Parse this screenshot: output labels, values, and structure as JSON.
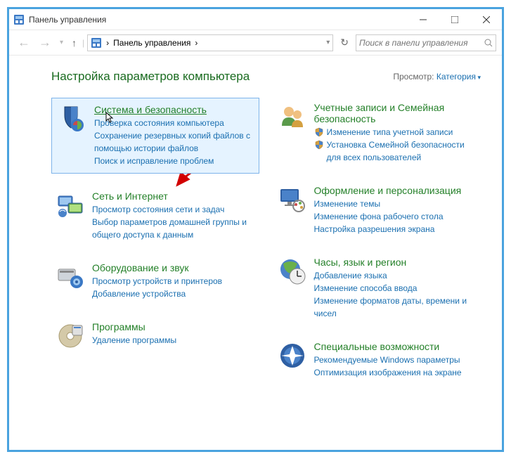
{
  "window": {
    "title": "Панель управления"
  },
  "address": {
    "breadcrumb": "Панель управления",
    "chevron": "›"
  },
  "search": {
    "placeholder": "Поиск в панели управления"
  },
  "header": {
    "title": "Настройка параметров компьютера"
  },
  "view_by": {
    "label": "Просмотр:",
    "mode": "Категория"
  },
  "left_col": [
    {
      "id": "system-security",
      "title": "Система и безопасность",
      "highlight": true,
      "subs": [
        {
          "text": "Проверка состояния компьютера"
        },
        {
          "text": "Сохранение резервных копий файлов с помощью истории файлов"
        },
        {
          "text": "Поиск и исправление проблем"
        }
      ]
    },
    {
      "id": "network",
      "title": "Сеть и Интернет",
      "subs": [
        {
          "text": "Просмотр состояния сети и задач"
        },
        {
          "text": "Выбор параметров домашней группы и общего доступа к данным"
        }
      ]
    },
    {
      "id": "hardware-sound",
      "title": "Оборудование и звук",
      "subs": [
        {
          "text": "Просмотр устройств и принтеров"
        },
        {
          "text": "Добавление устройства"
        }
      ]
    },
    {
      "id": "programs",
      "title": "Программы",
      "subs": [
        {
          "text": "Удаление программы"
        }
      ]
    }
  ],
  "right_col": [
    {
      "id": "user-accounts",
      "title": "Учетные записи и Семейная безопасность",
      "subs": [
        {
          "text": "Изменение типа учетной записи",
          "shield": true
        },
        {
          "text": "Установка Семейной безопасности для всех пользователей",
          "shield": true
        }
      ]
    },
    {
      "id": "appearance",
      "title": "Оформление и персонализация",
      "subs": [
        {
          "text": "Изменение темы"
        },
        {
          "text": "Изменение фона рабочего стола"
        },
        {
          "text": "Настройка разрешения экрана"
        }
      ]
    },
    {
      "id": "clock",
      "title": "Часы, язык и регион",
      "subs": [
        {
          "text": "Добавление языка"
        },
        {
          "text": "Изменение способа ввода"
        },
        {
          "text": "Изменение форматов даты, времени и чисел"
        }
      ]
    },
    {
      "id": "accessibility",
      "title": "Специальные возможности",
      "subs": [
        {
          "text": "Рекомендуемые Windows параметры"
        },
        {
          "text": "Оптимизация изображения на экране"
        }
      ]
    }
  ]
}
